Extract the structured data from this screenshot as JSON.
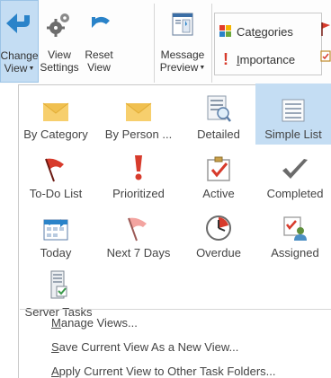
{
  "ribbon": {
    "change_view": {
      "line1": "Change",
      "line2": "View"
    },
    "view_settings": {
      "line1": "View",
      "line2": "Settings"
    },
    "reset_view": {
      "line1": "Reset",
      "line2": "View"
    },
    "message_preview": {
      "line1": "Message",
      "line2": "Preview"
    },
    "categories": {
      "pre": "Cat",
      "ul": "e",
      "post": "gories"
    },
    "importance": {
      "ul": "I",
      "post": "mportance"
    }
  },
  "views": [
    {
      "label": "By Category",
      "icon": "envelope-icon"
    },
    {
      "label": "By Person ...",
      "icon": "envelope-icon"
    },
    {
      "label": "Detailed",
      "icon": "detailed-list-icon"
    },
    {
      "label": "Simple List",
      "icon": "simple-list-icon",
      "selected": true
    },
    {
      "label": "To-Do List",
      "icon": "red-flag-icon"
    },
    {
      "label": "Prioritized",
      "icon": "exclamation-icon"
    },
    {
      "label": "Active",
      "icon": "checkbox-icon"
    },
    {
      "label": "Completed",
      "icon": "checkmark-icon"
    },
    {
      "label": "Today",
      "icon": "calendar-arrow-icon"
    },
    {
      "label": "Next 7 Days",
      "icon": "pink-flag-icon"
    },
    {
      "label": "Overdue",
      "icon": "clock-icon"
    },
    {
      "label": "Assigned",
      "icon": "assigned-person-icon"
    },
    {
      "label": "Server Tasks",
      "icon": "server-tasks-icon"
    }
  ],
  "menu": [
    {
      "ul": "M",
      "rest": "anage Views..."
    },
    {
      "ul": "S",
      "rest": "ave Current View As a New View..."
    },
    {
      "ul": "A",
      "rest": "pply Current View to Other Task Folders..."
    }
  ],
  "colors": {
    "selected_bg": "#c4ddf3",
    "accent_blue": "#2a83c9",
    "flag_red": "#d73b2c"
  }
}
